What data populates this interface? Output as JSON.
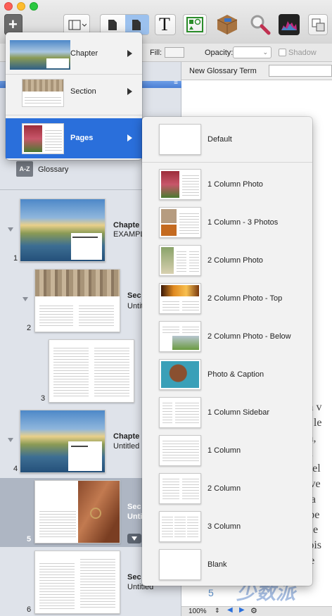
{
  "toolbar": {
    "add_icon": "plus-icon",
    "view_icon": "view-icon"
  },
  "formatbar": {
    "fill_label": "Fill:",
    "opacity_label": "Opacity:",
    "shadow_label": "Shadow"
  },
  "glossary_bar": {
    "new_term_label": "New Glossary Term"
  },
  "sidebar": {
    "glossary_badge": "A-Z",
    "glossary_label": "Glossary",
    "pages": [
      {
        "num": "1",
        "title": "Chapte",
        "subtitle": "EXAMPL"
      },
      {
        "num": "2",
        "title": "Sec",
        "subtitle": "Untitl"
      },
      {
        "num": "3",
        "title": "",
        "subtitle": ""
      },
      {
        "num": "4",
        "title": "Chapte",
        "subtitle": "Untitled"
      },
      {
        "num": "5",
        "title": "Sec",
        "subtitle": "Unti"
      },
      {
        "num": "6",
        "title": "Sec",
        "subtitle": "Untitled"
      }
    ]
  },
  "main_menu": {
    "items": [
      "Chapter",
      "Section",
      "Pages"
    ]
  },
  "pages_submenu": {
    "items": [
      "Default",
      "1 Column Photo",
      "1 Column - 3 Photos",
      "2 Column Photo",
      "2 Column Photo - Top",
      "2 Column Photo - Below",
      "Photo & Caption",
      "1 Column Sidebar",
      "1 Column",
      "2 Column",
      "3 Column",
      "Blank"
    ]
  },
  "document": {
    "lines": [
      "um v",
      "mi le",
      "um,",
      "ssa",
      "c vel",
      "et ve",
      " vita",
      "uspe",
      "ng e",
      "urpis",
      "ege"
    ],
    "page_number": "5"
  },
  "statusbar": {
    "zoom": "100%"
  },
  "watermark": "少数派"
}
